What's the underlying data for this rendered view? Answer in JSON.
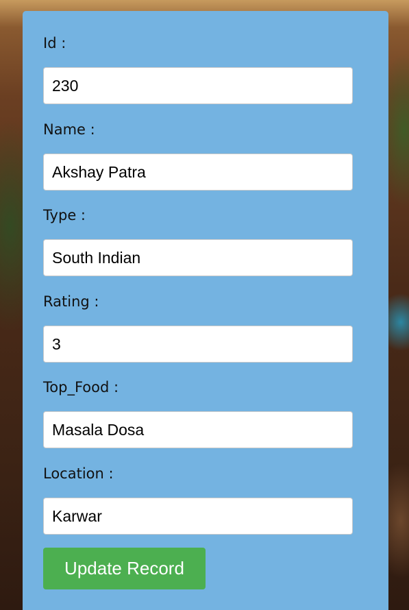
{
  "colors": {
    "card_background": "#74b3e1",
    "button_background": "#4caf50",
    "button_text": "#ffffff"
  },
  "form": {
    "fields": [
      {
        "label": "Id :",
        "value": "230"
      },
      {
        "label": "Name :",
        "value": "Akshay Patra"
      },
      {
        "label": "Type :",
        "value": "South Indian"
      },
      {
        "label": "Rating :",
        "value": "3"
      },
      {
        "label": "Top_Food :",
        "value": "Masala Dosa"
      },
      {
        "label": "Location :",
        "value": "Karwar"
      }
    ],
    "submit_label": "Update Record"
  }
}
